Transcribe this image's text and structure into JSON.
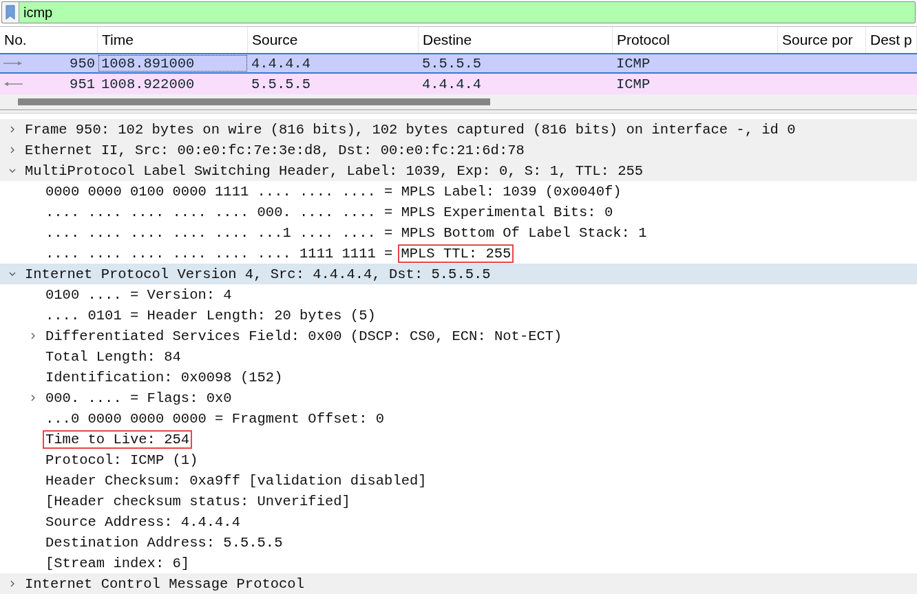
{
  "filter": {
    "value": "icmp"
  },
  "packet_list": {
    "columns": [
      "No.",
      "Time",
      "Source",
      "Destine",
      "Protocol",
      "Source por",
      "Dest p"
    ],
    "rows": [
      {
        "kind": "request",
        "selected": true,
        "cells": [
          "950",
          "1008.891000",
          "4.4.4.4",
          "5.5.5.5",
          "ICMP",
          "",
          ""
        ]
      },
      {
        "kind": "reply",
        "selected": false,
        "cells": [
          "951",
          "1008.922000",
          "5.5.5.5",
          "4.4.4.4",
          "ICMP",
          "",
          ""
        ]
      }
    ]
  },
  "details": [
    {
      "text": "Frame 950: 102 bytes on wire (816 bits), 102 bytes captured (816 bits) on interface -, id 0",
      "expanded": false,
      "selected": false,
      "highlighted": false
    },
    {
      "text": "Ethernet II, Src: 00:e0:fc:7e:3e:d8, Dst: 00:e0:fc:21:6d:78",
      "expanded": false,
      "selected": false,
      "highlighted": false
    },
    {
      "text": "MultiProtocol Label Switching Header, Label: 1039, Exp: 0, S: 1, TTL: 255",
      "expanded": true,
      "selected": false,
      "highlighted": false,
      "children": [
        {
          "text": "0000 0000 0100 0000 1111 .... .... .... = MPLS Label: 1039 (0x0040f)",
          "selected": false,
          "highlighted": false
        },
        {
          "text": ".... .... .... .... .... 000. .... .... = MPLS Experimental Bits: 0",
          "selected": false,
          "highlighted": false
        },
        {
          "text": ".... .... .... .... .... ...1 .... .... = MPLS Bottom Of Label Stack: 1",
          "selected": false,
          "highlighted": false
        },
        {
          "bits": ".... .... .... .... .... .... 1111 1111 =",
          "text": "MPLS TTL: 255",
          "selected": false,
          "highlighted": true
        }
      ]
    },
    {
      "text": "Internet Protocol Version 4, Src: 4.4.4.4, Dst: 5.5.5.5",
      "expanded": true,
      "selected": true,
      "highlighted": false,
      "children": [
        {
          "text": "0100 .... = Version: 4",
          "selected": false,
          "highlighted": false
        },
        {
          "text": ".... 0101 = Header Length: 20 bytes (5)",
          "selected": false,
          "highlighted": false
        },
        {
          "text": "Differentiated Services Field: 0x00 (DSCP: CS0, ECN: Not-ECT)",
          "expanded": false,
          "selected": false,
          "highlighted": false
        },
        {
          "text": "Total Length: 84",
          "selected": false,
          "highlighted": false
        },
        {
          "text": "Identification: 0x0098 (152)",
          "selected": false,
          "highlighted": false
        },
        {
          "text": "000. .... = Flags: 0x0",
          "expanded": false,
          "selected": false,
          "highlighted": false
        },
        {
          "text": "...0 0000 0000 0000 = Fragment Offset: 0",
          "selected": false,
          "highlighted": false
        },
        {
          "text": "Time to Live: 254",
          "selected": false,
          "highlighted": true
        },
        {
          "text": "Protocol: ICMP (1)",
          "selected": false,
          "highlighted": false
        },
        {
          "text": "Header Checksum: 0xa9ff [validation disabled]",
          "selected": false,
          "highlighted": false
        },
        {
          "text": "[Header checksum status: Unverified]",
          "selected": false,
          "highlighted": false
        },
        {
          "text": "Source Address: 4.4.4.4",
          "selected": false,
          "highlighted": false
        },
        {
          "text": "Destination Address: 5.5.5.5",
          "selected": false,
          "highlighted": false
        },
        {
          "text": "[Stream index: 6]",
          "selected": false,
          "highlighted": false
        }
      ]
    },
    {
      "text": "Internet Control Message Protocol",
      "expanded": false,
      "selected": false,
      "highlighted": false
    }
  ]
}
